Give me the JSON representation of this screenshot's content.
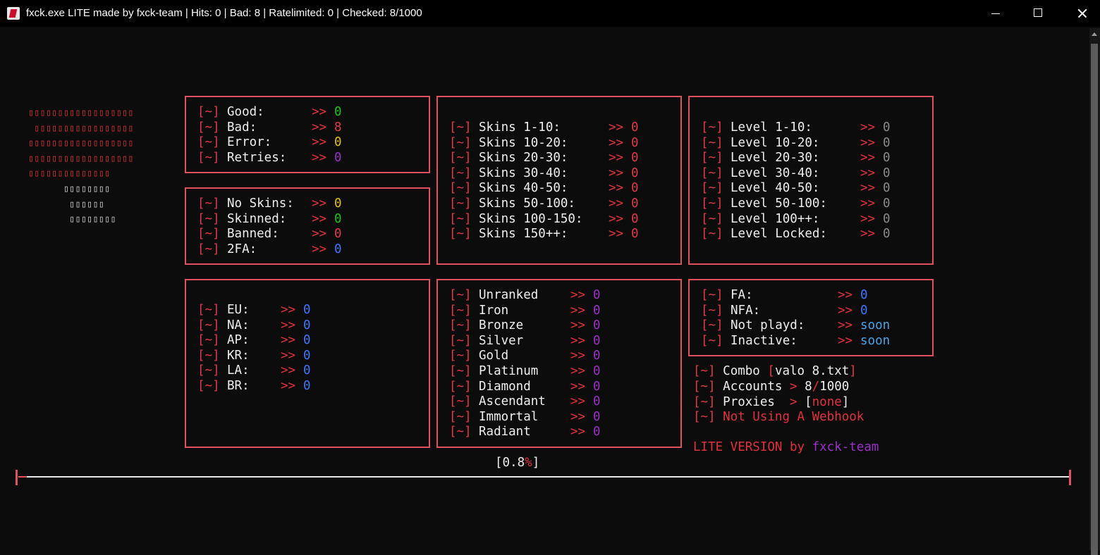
{
  "window": {
    "title": "fxck.exe LITE made by fxck-team | Hits: 0 | Bad: 8 | Ratelimited: 0 | Checked: 8/1000"
  },
  "logo": {
    "lines": [
      "▯▯▯▯▯▯▯▯▯▯▯▯▯▯▯▯▯▯",
      " ▯▯▯▯▯▯▯▯▯▯▯▯▯▯▯▯▯",
      "▯▯▯▯▯▯▯▯▯▯▯▯▯▯▯▯▯▯",
      "▯▯▯▯▯▯▯▯▯▯▯▯▯▯▯▯▯▯",
      "▯▯▯▯▯▯▯▯▯▯▯▯▯▯",
      "      ▯▯▯▯▯▯▯▯",
      "       ▯▯▯▯▯▯",
      "       ▯▯▯▯▯▯▯▯"
    ]
  },
  "prefix": "[~]",
  "arrow": ">>",
  "stats": [
    {
      "label": "Good:",
      "value": "0",
      "color": "green"
    },
    {
      "label": "Bad:",
      "value": "8",
      "color": "red"
    },
    {
      "label": "Error:",
      "value": "0",
      "color": "yellow"
    },
    {
      "label": "Retries:",
      "value": "0",
      "color": "purple"
    }
  ],
  "skin_status": [
    {
      "label": "No Skins:",
      "value": "0",
      "color": "yellow"
    },
    {
      "label": "Skinned:",
      "value": "0",
      "color": "green"
    },
    {
      "label": "Banned:",
      "value": "0",
      "color": "red"
    },
    {
      "label": "2FA:",
      "value": "0",
      "color": "blue"
    }
  ],
  "skins": [
    {
      "label": "Skins 1-10:",
      "value": "0"
    },
    {
      "label": "Skins 10-20:",
      "value": "0"
    },
    {
      "label": "Skins 20-30:",
      "value": "0"
    },
    {
      "label": "Skins 30-40:",
      "value": "0"
    },
    {
      "label": "Skins 40-50:",
      "value": "0"
    },
    {
      "label": "Skins 50-100:",
      "value": "0"
    },
    {
      "label": "Skins 100-150:",
      "value": "0"
    },
    {
      "label": "Skins 150++:",
      "value": "0"
    }
  ],
  "levels": [
    {
      "label": "Level 1-10:",
      "value": "0"
    },
    {
      "label": "Level 10-20:",
      "value": "0"
    },
    {
      "label": "Level 20-30:",
      "value": "0"
    },
    {
      "label": "Level 30-40:",
      "value": "0"
    },
    {
      "label": "Level 40-50:",
      "value": "0"
    },
    {
      "label": "Level 50-100:",
      "value": "0"
    },
    {
      "label": "Level 100++:",
      "value": "0"
    },
    {
      "label": "Level Locked:",
      "value": "0"
    }
  ],
  "regions": [
    {
      "label": "EU:",
      "value": "0"
    },
    {
      "label": "NA:",
      "value": "0"
    },
    {
      "label": "AP:",
      "value": "0"
    },
    {
      "label": "KR:",
      "value": "0"
    },
    {
      "label": "LA:",
      "value": "0"
    },
    {
      "label": "BR:",
      "value": "0"
    }
  ],
  "ranks": [
    {
      "label": "Unranked",
      "value": "0"
    },
    {
      "label": "Iron",
      "value": "0"
    },
    {
      "label": "Bronze",
      "value": "0"
    },
    {
      "label": "Silver",
      "value": "0"
    },
    {
      "label": "Gold",
      "value": "0"
    },
    {
      "label": "Platinum",
      "value": "0"
    },
    {
      "label": "Diamond",
      "value": "0"
    },
    {
      "label": "Ascendant",
      "value": "0"
    },
    {
      "label": "Immortal",
      "value": "0"
    },
    {
      "label": "Radiant",
      "value": "0"
    }
  ],
  "access": [
    {
      "label": "FA:",
      "value": "0"
    },
    {
      "label": "NFA:",
      "value": "0"
    },
    {
      "label": "Not playd:",
      "value": "soon"
    },
    {
      "label": "Inactive:",
      "value": "soon"
    }
  ],
  "info": {
    "combo_label": "Combo",
    "combo_open": "[",
    "combo_file": "valo 8.txt",
    "combo_close": "]",
    "accounts_label": "Accounts",
    "accounts_arrow": ">",
    "accounts_checked": "8",
    "accounts_sep": "/",
    "accounts_total": "1000",
    "proxies_label": "Proxies",
    "proxies_arrow": ">",
    "proxies_open": "[",
    "proxies_value": "none",
    "proxies_close": "]",
    "webhook_text": "Not Using A Webhook",
    "version_text": "LITE VERSION by",
    "team_text": "fxck-team"
  },
  "progress": {
    "open": "[",
    "value": "0.8",
    "unit": "%",
    "close": "]",
    "fraction": 0.008
  },
  "colors": {
    "accent": "#e0505f",
    "green": "#16c60c",
    "red": "#e23848",
    "yellow": "#e5c100",
    "purple": "#9b2fc8",
    "blue": "#3b78ff",
    "gray": "#8a8a8a",
    "sky": "#4aa3e8"
  }
}
